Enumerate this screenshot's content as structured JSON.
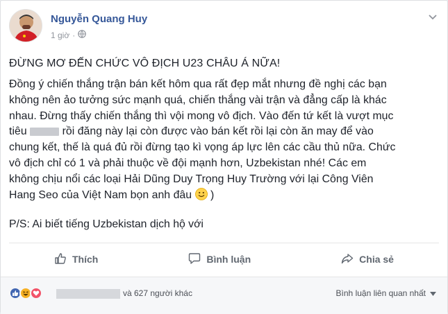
{
  "post": {
    "author_name": "Nguyễn Quang Huy",
    "time": "1 giờ",
    "title": "ĐỪNG MƠ ĐẾN CHỨC VÔ ĐỊCH U23 CHÂU Á NỮA!",
    "body_lines": [
      "Đồng ý chiến thắng trận bán kết hôm qua rất đẹp mắt nhưng đề nghị các bạn",
      "không nên ảo tưởng sức mạnh quá, chiến thắng vài trận và đẳng cấp là khác",
      "nhau. Đừng thấy chiến thắng thì vội mong vô địch. Vào đến tứ kết là vượt mục",
      "tiêu",
      "rồi đăng này lại còn được vào bán kết rồi lại còn ăn may để vào",
      "chung kết, thế là quá đủ rồi đừng tạo kì vọng áp lực lên các cầu thủ nữa. Chức",
      "vô địch chỉ có 1 và phải thuộc về đội mạnh hơn, Uzbekistan nhé! Các em",
      "không chịu nổi các loại Hải Dũng Duy Trọng Huy Trường với lại Công Viên",
      "Hang Seo của Việt Nam bọn anh đâu",
      ")"
    ],
    "ps": "P/S: Ai biết tiếng Uzbekistan dịch hộ với"
  },
  "actions": {
    "like": "Thích",
    "comment": "Bình luận",
    "share": "Chia sẻ"
  },
  "footer": {
    "others_text": "và 627 người khác",
    "sort_label": "Bình luận liên quan nhất"
  },
  "colors": {
    "author_link": "#365899",
    "like_blue": "#4267b2",
    "haha_yellow": "#f7b125",
    "love_red": "#f25268"
  }
}
